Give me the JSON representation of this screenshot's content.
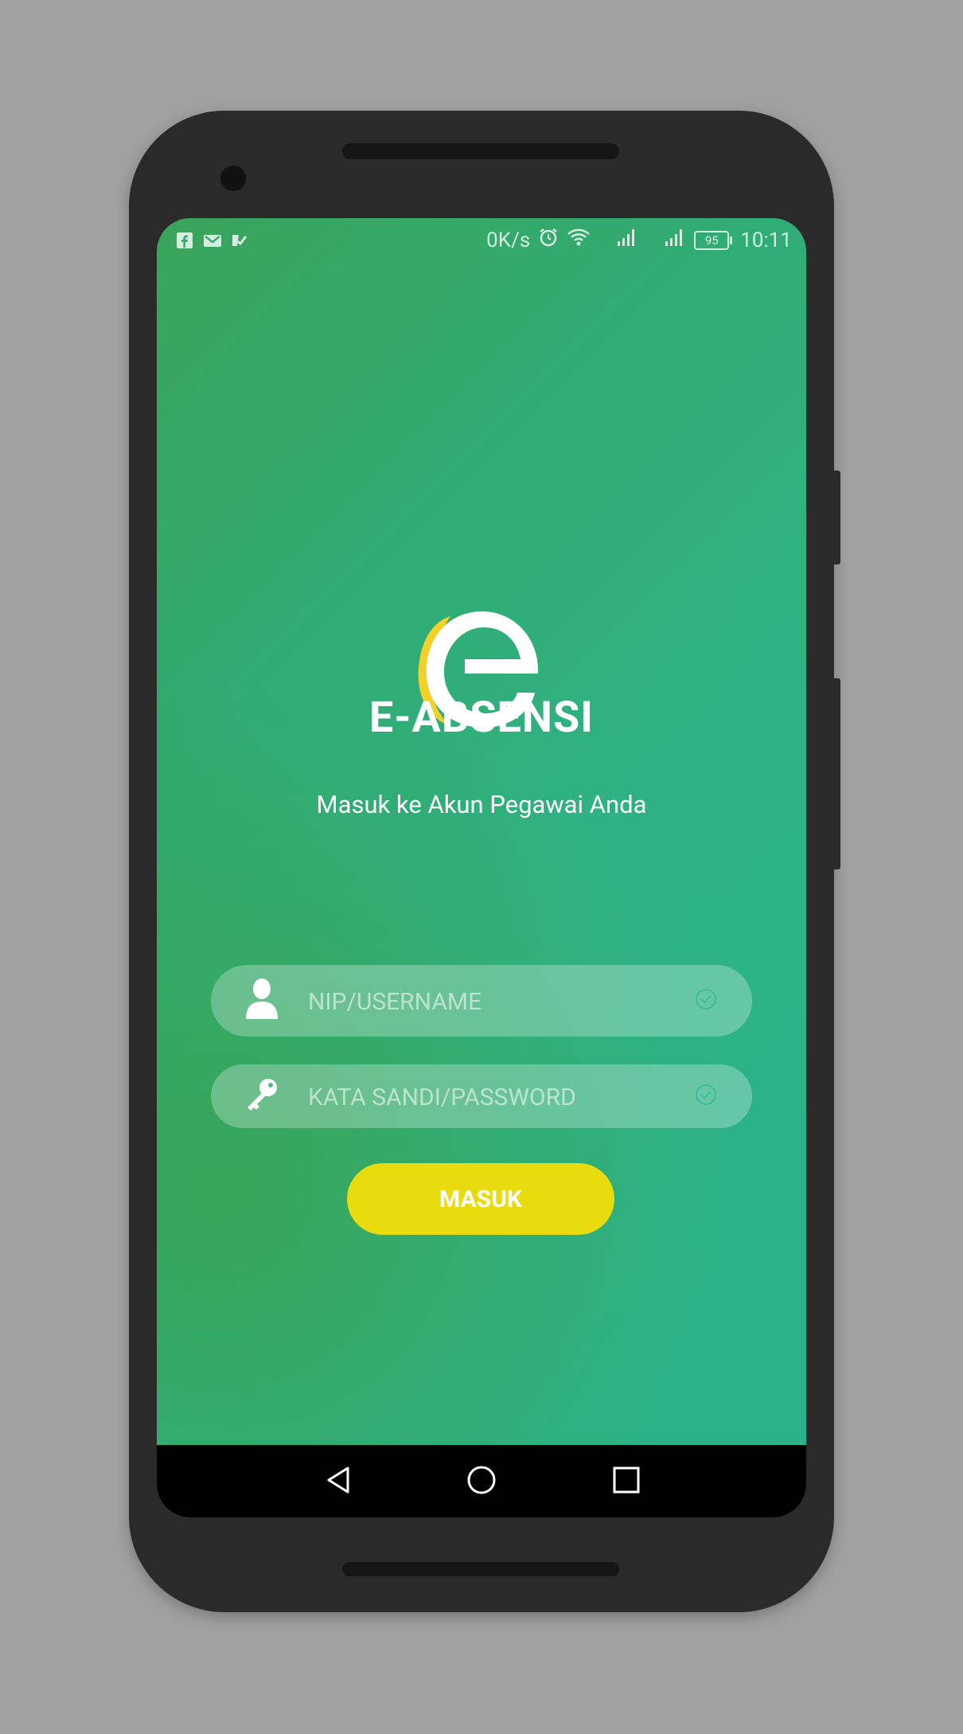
{
  "status_bar": {
    "notification_icons": [
      "facebook-icon",
      "gmail-icon",
      "task-icon"
    ],
    "network_speed": "0K/s",
    "battery_level": "95",
    "time": "10:11"
  },
  "app": {
    "title": "E-ABSENSI",
    "subtitle": "Masuk ke Akun Pegawai Anda",
    "logo": "e-absensi-logo"
  },
  "form": {
    "username_placeholder": "NIP/USERNAME",
    "username_value": "",
    "password_placeholder": "KATA SANDI/PASSWORD",
    "password_value": "",
    "submit_label": "MASUK"
  },
  "navigation": {
    "buttons": [
      "back-icon",
      "home-icon",
      "recents-icon"
    ]
  },
  "colors": {
    "gradient_green": "#30ac74",
    "accent_yellow": "#e9dc0e",
    "logo_yellow": "#f2d22a"
  }
}
